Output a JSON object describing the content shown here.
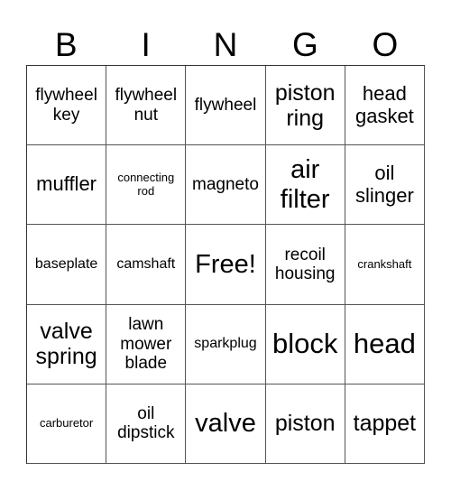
{
  "header": [
    "B",
    "I",
    "N",
    "G",
    "O"
  ],
  "cells": [
    [
      "flywheel key",
      "flywheel nut",
      "flywheel",
      "piston ring",
      "head gasket"
    ],
    [
      "muffler",
      "connecting rod",
      "magneto",
      "air filter",
      "oil slinger"
    ],
    [
      "baseplate",
      "camshaft",
      "Free!",
      "recoil housing",
      "crankshaft"
    ],
    [
      "valve spring",
      "lawn mower blade",
      "sparkplug",
      "block",
      "head"
    ],
    [
      "carburetor",
      "oil dipstick",
      "valve",
      "piston",
      "tappet"
    ]
  ]
}
